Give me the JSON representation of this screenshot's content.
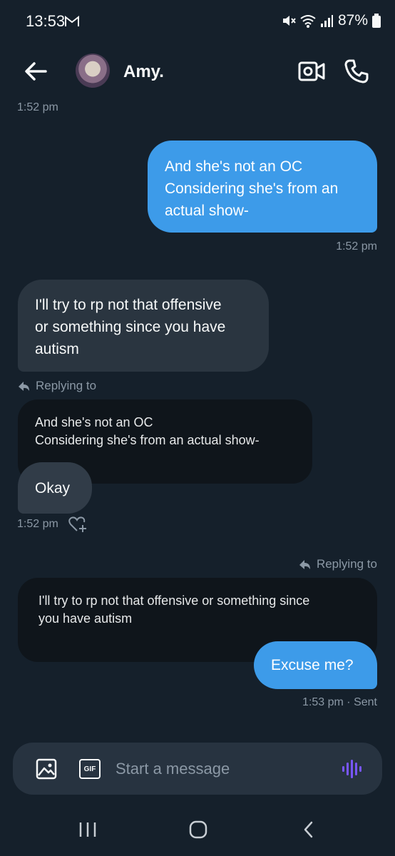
{
  "status_bar": {
    "time": "13:53",
    "battery": "87%"
  },
  "header": {
    "contact_name": "Amy."
  },
  "messages": {
    "top_timestamp": "1:52 pm",
    "m1": {
      "line1": "And she's not an OC",
      "line2": "Considering she's from an",
      "line3": "actual show-",
      "time": "1:52 pm"
    },
    "m2": {
      "line1": "I'll try to rp not that offensive",
      "line2": "or something since you have",
      "line3": "autism"
    },
    "m3": {
      "replying_to": "Replying to",
      "quote_line1": "And she's not an OC",
      "quote_line2": "Considering she's from an actual show-",
      "text": "Okay",
      "time": "1:52 pm"
    },
    "m4": {
      "replying_to": "Replying to",
      "quote_line1": "I'll try to rp not that offensive or something since",
      "quote_line2": "you have autism",
      "text": "Excuse me?",
      "time": "1:53 pm · Sent"
    }
  },
  "composer": {
    "placeholder": "Start a message",
    "gif_label": "GIF"
  },
  "colors": {
    "background": "#15202b",
    "outgoing_bubble": "#3d9be9",
    "incoming_bubble": "#2a3540",
    "voice_accent": "#7856ff"
  },
  "icons": [
    "back-arrow-icon",
    "video-icon",
    "phone-icon",
    "image-icon",
    "gif-icon",
    "voice-icon",
    "reply-arrow-icon",
    "heart-add-icon"
  ]
}
